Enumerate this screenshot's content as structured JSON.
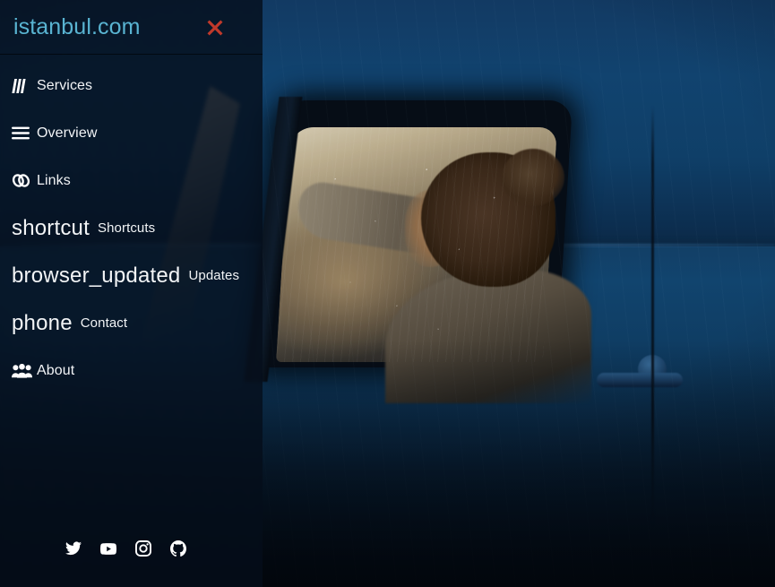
{
  "brand": {
    "title": "istanbul.com",
    "title_color": "#59b4d2"
  },
  "header": {
    "close_label": "×",
    "close_icon": "close-x-icon",
    "close_color": "#c0392b"
  },
  "nav": {
    "items": [
      {
        "label": "Services",
        "icon": "signal-bars-icon",
        "icon_kind": "glyph",
        "icon_text": ""
      },
      {
        "label": "Overview",
        "icon": "hamburger-menu-icon",
        "icon_kind": "glyph",
        "icon_text": ""
      },
      {
        "label": "Links",
        "icon": "chain-link-icon",
        "icon_kind": "glyph",
        "icon_text": ""
      },
      {
        "label": "Shortcuts",
        "icon": "shortcut-icon",
        "icon_kind": "text",
        "icon_text": "shortcut"
      },
      {
        "label": "Updates",
        "icon": "browser-updated-icon",
        "icon_kind": "text",
        "icon_text": "browser_updated"
      },
      {
        "label": "Contact",
        "icon": "phone-icon",
        "icon_kind": "text",
        "icon_text": "phone"
      },
      {
        "label": "About",
        "icon": "users-group-icon",
        "icon_kind": "glyph",
        "icon_text": ""
      }
    ]
  },
  "social": {
    "links": [
      {
        "name": "twitter",
        "icon": "twitter-icon"
      },
      {
        "name": "youtube",
        "icon": "youtube-icon"
      },
      {
        "name": "instagram",
        "icon": "instagram-icon"
      },
      {
        "name": "github",
        "icon": "github-icon"
      }
    ]
  },
  "background": {
    "description": "Woman seated inside a blue pickup truck at dusk, arm reaching toward the rain-streaked windshield",
    "tint": "#0c2744"
  }
}
